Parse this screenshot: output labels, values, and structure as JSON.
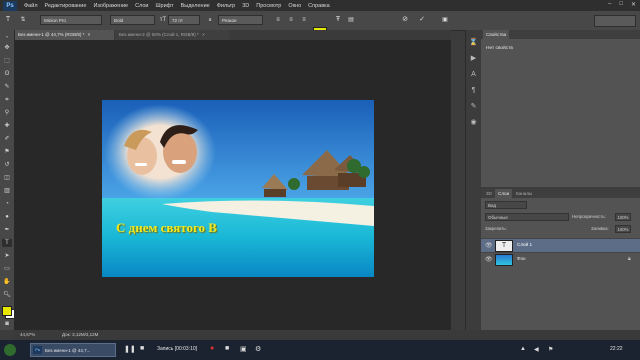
{
  "app": {
    "logo": "Ps"
  },
  "menu": [
    "Файл",
    "Редактирование",
    "Изображение",
    "Слои",
    "Шрифт",
    "Выделение",
    "Фильтр",
    "3D",
    "Просмотр",
    "Окно",
    "Справка"
  ],
  "window_controls": [
    "–",
    "□",
    "✕"
  ],
  "options": {
    "font_family": "Minion Pro",
    "font_style": "Bold",
    "font_size": "72 пт",
    "aa_label": "a",
    "aa_mode": "Резкое",
    "text_color": "#e8e800"
  },
  "tabs": [
    {
      "label": "Без имени-1 @ 44,7% (RGB/8) *",
      "close": "×"
    },
    {
      "label": "Без имени-2 @ 50% (Слой 1, RGB/8) *",
      "close": "×"
    }
  ],
  "image": {
    "greeting": "С днем святого В"
  },
  "properties": {
    "tab": "Свойства",
    "empty": "Нет свойств"
  },
  "layers_panel": {
    "tabs": [
      "3D",
      "Слои",
      "Каналы"
    ],
    "filter_kind": "Вид",
    "blend_mode": "Обычные",
    "opacity_label": "Непрозрачность:",
    "opacity_value": "100%",
    "lock_label": "Закрепить:",
    "fill_label": "Заливка:",
    "fill_value": "100%",
    "layers": [
      {
        "name": "Слой 1",
        "selected": true
      },
      {
        "name": "Фон",
        "selected": false
      }
    ]
  },
  "status": {
    "zoom": "44,67%",
    "doc": "Док: 3,12M/3,12M"
  },
  "taskbar": {
    "item1": "Без имени-1 @ 44,7...",
    "record": "Запись [00:03:10]",
    "clock": "22:22"
  }
}
